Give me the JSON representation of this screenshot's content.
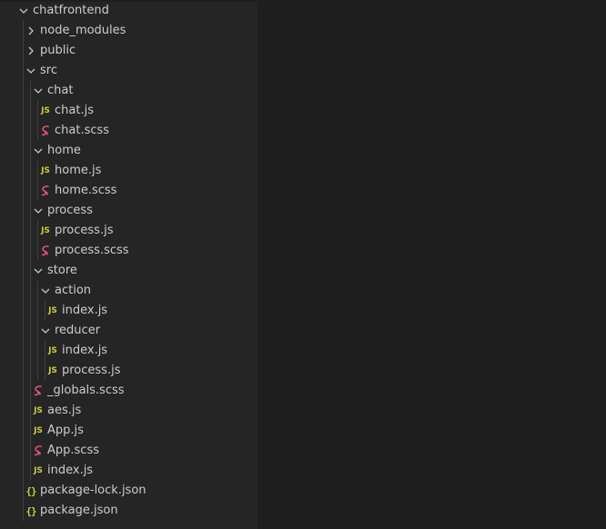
{
  "explorer": {
    "colors": {
      "background": "#252526",
      "text": "#cccccc",
      "js_icon": "#cbcb41",
      "json_icon": "#cbcb41",
      "sass_icon": "#f55385",
      "chevron": "#c5c5c5",
      "editor_background": "#1e1e1e"
    },
    "tree": [
      {
        "label": "chatfrontend",
        "type": "folder",
        "expanded": true,
        "depth": 0,
        "icon": "chevron-down-icon"
      },
      {
        "label": "node_modules",
        "type": "folder",
        "expanded": false,
        "depth": 1,
        "icon": "chevron-right-icon"
      },
      {
        "label": "public",
        "type": "folder",
        "expanded": false,
        "depth": 1,
        "icon": "chevron-right-icon"
      },
      {
        "label": "src",
        "type": "folder",
        "expanded": true,
        "depth": 1,
        "icon": "chevron-down-icon"
      },
      {
        "label": "chat",
        "type": "folder",
        "expanded": true,
        "depth": 2,
        "icon": "chevron-down-icon"
      },
      {
        "label": "chat.js",
        "type": "js",
        "depth": 3,
        "icon": "js-file-icon",
        "icon_text": "JS"
      },
      {
        "label": "chat.scss",
        "type": "scss",
        "depth": 3,
        "icon": "sass-file-icon"
      },
      {
        "label": "home",
        "type": "folder",
        "expanded": true,
        "depth": 2,
        "icon": "chevron-down-icon"
      },
      {
        "label": "home.js",
        "type": "js",
        "depth": 3,
        "icon": "js-file-icon",
        "icon_text": "JS"
      },
      {
        "label": "home.scss",
        "type": "scss",
        "depth": 3,
        "icon": "sass-file-icon"
      },
      {
        "label": "process",
        "type": "folder",
        "expanded": true,
        "depth": 2,
        "icon": "chevron-down-icon"
      },
      {
        "label": "process.js",
        "type": "js",
        "depth": 3,
        "icon": "js-file-icon",
        "icon_text": "JS"
      },
      {
        "label": "process.scss",
        "type": "scss",
        "depth": 3,
        "icon": "sass-file-icon"
      },
      {
        "label": "store",
        "type": "folder",
        "expanded": true,
        "depth": 2,
        "icon": "chevron-down-icon"
      },
      {
        "label": "action",
        "type": "folder",
        "expanded": true,
        "depth": 3,
        "icon": "chevron-down-icon"
      },
      {
        "label": "index.js",
        "type": "js",
        "depth": 4,
        "icon": "js-file-icon",
        "icon_text": "JS"
      },
      {
        "label": "reducer",
        "type": "folder",
        "expanded": true,
        "depth": 3,
        "icon": "chevron-down-icon"
      },
      {
        "label": "index.js",
        "type": "js",
        "depth": 4,
        "icon": "js-file-icon",
        "icon_text": "JS"
      },
      {
        "label": "process.js",
        "type": "js",
        "depth": 4,
        "icon": "js-file-icon",
        "icon_text": "JS"
      },
      {
        "label": "_globals.scss",
        "type": "scss",
        "depth": 2,
        "icon": "sass-file-icon"
      },
      {
        "label": "aes.js",
        "type": "js",
        "depth": 2,
        "icon": "js-file-icon",
        "icon_text": "JS"
      },
      {
        "label": "App.js",
        "type": "js",
        "depth": 2,
        "icon": "js-file-icon",
        "icon_text": "JS"
      },
      {
        "label": "App.scss",
        "type": "scss",
        "depth": 2,
        "icon": "sass-file-icon"
      },
      {
        "label": "index.js",
        "type": "js",
        "depth": 2,
        "icon": "js-file-icon",
        "icon_text": "JS"
      },
      {
        "label": "package-lock.json",
        "type": "json",
        "depth": 1,
        "icon": "json-file-icon",
        "icon_text": "{}"
      },
      {
        "label": "package.json",
        "type": "json",
        "depth": 1,
        "icon": "json-file-icon",
        "icon_text": "{}"
      }
    ]
  }
}
